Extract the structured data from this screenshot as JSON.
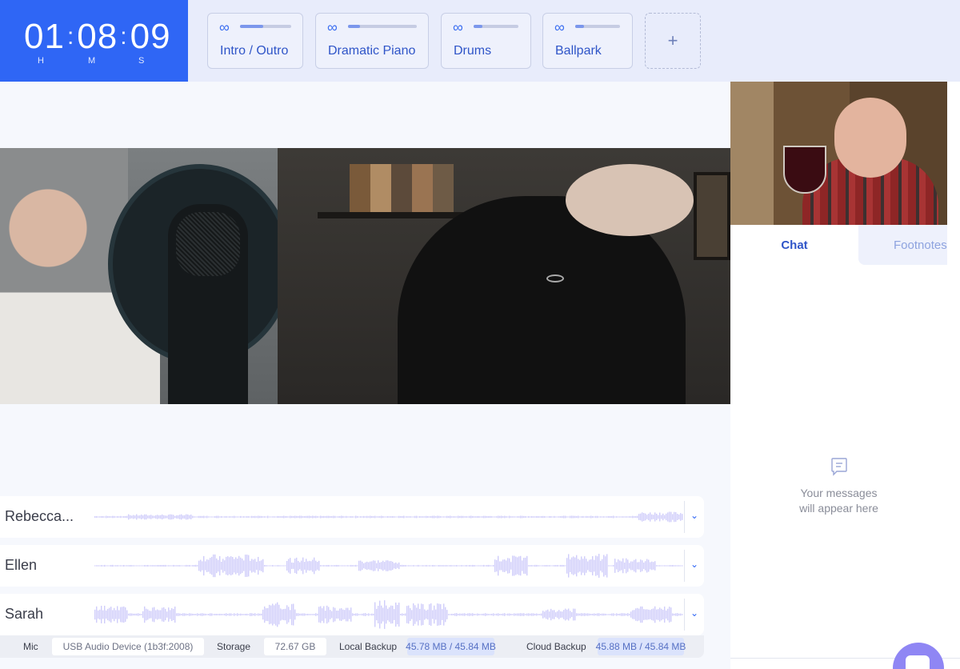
{
  "timer": {
    "hours": "01",
    "minutes": "08",
    "seconds": "09",
    "h_label": "H",
    "m_label": "M",
    "s_label": "S"
  },
  "sounds": [
    {
      "label": "Intro / Outro",
      "icon": "infinity-loop-icon",
      "progress": 0.45
    },
    {
      "label": "Dramatic Piano",
      "icon": "infinity-loop-icon",
      "progress": 0.18
    },
    {
      "label": "Drums",
      "icon": "infinity-loop-icon",
      "progress": 0.2
    },
    {
      "label": "Ballpark",
      "icon": "infinity-loop-icon",
      "progress": 0.2
    }
  ],
  "add_sound": {
    "label": "+"
  },
  "tracks": [
    {
      "name": "Rebecca..."
    },
    {
      "name": "Ellen"
    },
    {
      "name": "Sarah"
    }
  ],
  "status": {
    "mic_label": "Mic",
    "mic_value": "USB Audio Device (1b3f:2008)",
    "storage_label": "Storage",
    "storage_value": "72.67 GB",
    "local_label": "Local Backup",
    "local_value": "45.78 MB / 45.84 MB",
    "cloud_label": "Cloud Backup",
    "cloud_value": "45.88 MB / 45.84 MB"
  },
  "sidebar": {
    "tab_chat": "Chat",
    "tab_footnotes": "Footnotes",
    "empty_line1": "Your messages",
    "empty_line2": "will appear here"
  },
  "colors": {
    "accent": "#2f66f5",
    "waveform": "#cfcdfa",
    "fab": "#8f86f4"
  }
}
